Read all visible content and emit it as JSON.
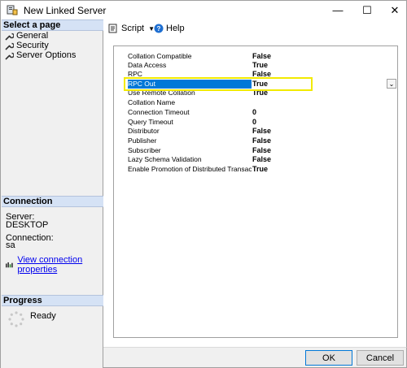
{
  "window": {
    "title": "New Linked Server",
    "minimize": "—",
    "maximize": "☐",
    "close": "✕"
  },
  "left": {
    "select_page_header": "Select a page",
    "pages": [
      {
        "label": "General"
      },
      {
        "label": "Security"
      },
      {
        "label": "Server Options"
      }
    ],
    "connection_header": "Connection",
    "server_label": "Server:",
    "server_value": "DESKTOP",
    "connection_label": "Connection:",
    "connection_value": "sa",
    "view_connection_link": "View connection properties",
    "progress_header": "Progress",
    "progress_status": "Ready"
  },
  "toolbar": {
    "script_label": "Script",
    "help_label": "Help"
  },
  "options": [
    {
      "name": "Collation Compatible",
      "value": "False"
    },
    {
      "name": "Data Access",
      "value": "True"
    },
    {
      "name": "RPC",
      "value": "False"
    },
    {
      "name": "RPC Out",
      "value": "True"
    },
    {
      "name": "Use Remote Collation",
      "value": "True"
    },
    {
      "name": "Collation Name",
      "value": ""
    },
    {
      "name": "Connection Timeout",
      "value": "0"
    },
    {
      "name": "Query Timeout",
      "value": "0"
    },
    {
      "name": "Distributor",
      "value": "False"
    },
    {
      "name": "Publisher",
      "value": "False"
    },
    {
      "name": "Subscriber",
      "value": "False"
    },
    {
      "name": "Lazy Schema Validation",
      "value": "False"
    },
    {
      "name": "Enable Promotion of Distributed Transaction",
      "value": "True"
    }
  ],
  "footer": {
    "ok_label": "OK",
    "cancel_label": "Cancel"
  },
  "colors": {
    "selection": "#0078d7",
    "highlight_box": "#f2ea00",
    "section_header": "#d5e2f5"
  },
  "icons": {
    "app": "linked-server-icon",
    "page": "wrench-icon",
    "script": "script-icon",
    "help": "help-icon",
    "connection": "connection-icon",
    "progress": "spinner-icon"
  }
}
